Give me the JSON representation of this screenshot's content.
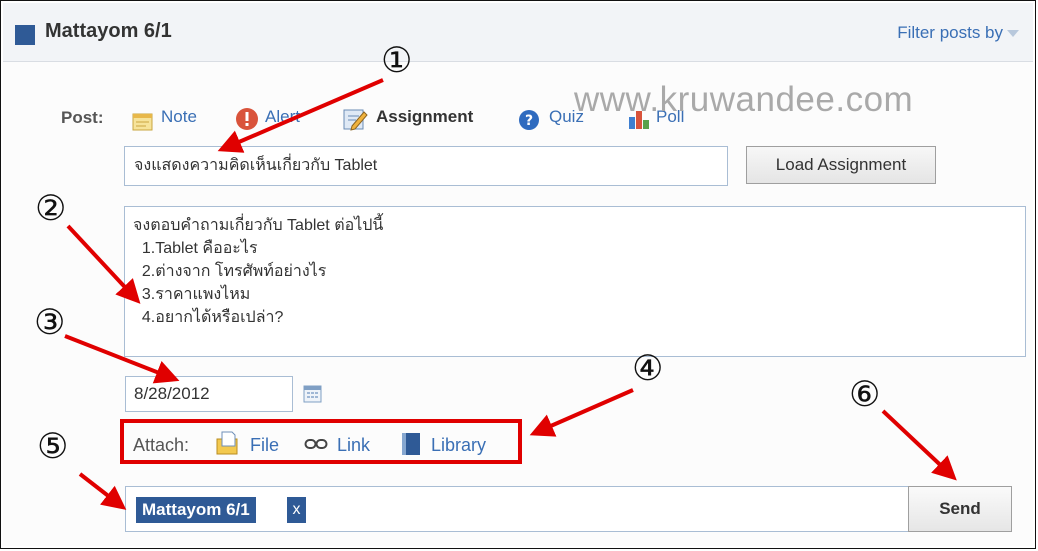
{
  "header": {
    "group_name": "Mattayom 6/1",
    "filter_label": "Filter posts by"
  },
  "composer": {
    "post_label": "Post:",
    "post_types": {
      "note": "Note",
      "alert": "Alert",
      "assignment": "Assignment",
      "quiz": "Quiz",
      "poll": "Poll"
    },
    "title_value": "จงแสดงความคิดเห็นเกี่ยวกับ Tablet",
    "load_assignment_label": "Load Assignment",
    "description_lines": [
      "จงตอบคำถามเกี่ยวกับ Tablet ต่อไปนี้",
      "  1.Tablet คืออะไร",
      "  2.ต่างจาก โทรศัพท์อย่างไร",
      "  3.ราคาแพงไหม",
      "  4.อยากได้หรือเปล่า?"
    ],
    "due_date": "8/28/2012",
    "attach": {
      "label": "Attach:",
      "file": "File",
      "link": "Link",
      "library": "Library"
    },
    "recipient": {
      "name": "Mattayom 6/1",
      "remove": "x"
    },
    "send_label": "Send"
  },
  "watermark": "www.kruwandee.com",
  "annotations": [
    "①",
    "②",
    "③",
    "④",
    "⑤",
    "⑥"
  ],
  "colors": {
    "brand_blue": "#2f5a96",
    "link_blue": "#3a6fb5",
    "annotation_red": "#e00000"
  },
  "icons": {
    "note": "note-icon",
    "alert": "alert-icon",
    "assignment": "assignment-icon",
    "quiz": "quiz-icon",
    "poll": "poll-icon",
    "calendar": "calendar-icon",
    "file": "file-icon",
    "link": "link-icon",
    "library": "library-icon"
  }
}
